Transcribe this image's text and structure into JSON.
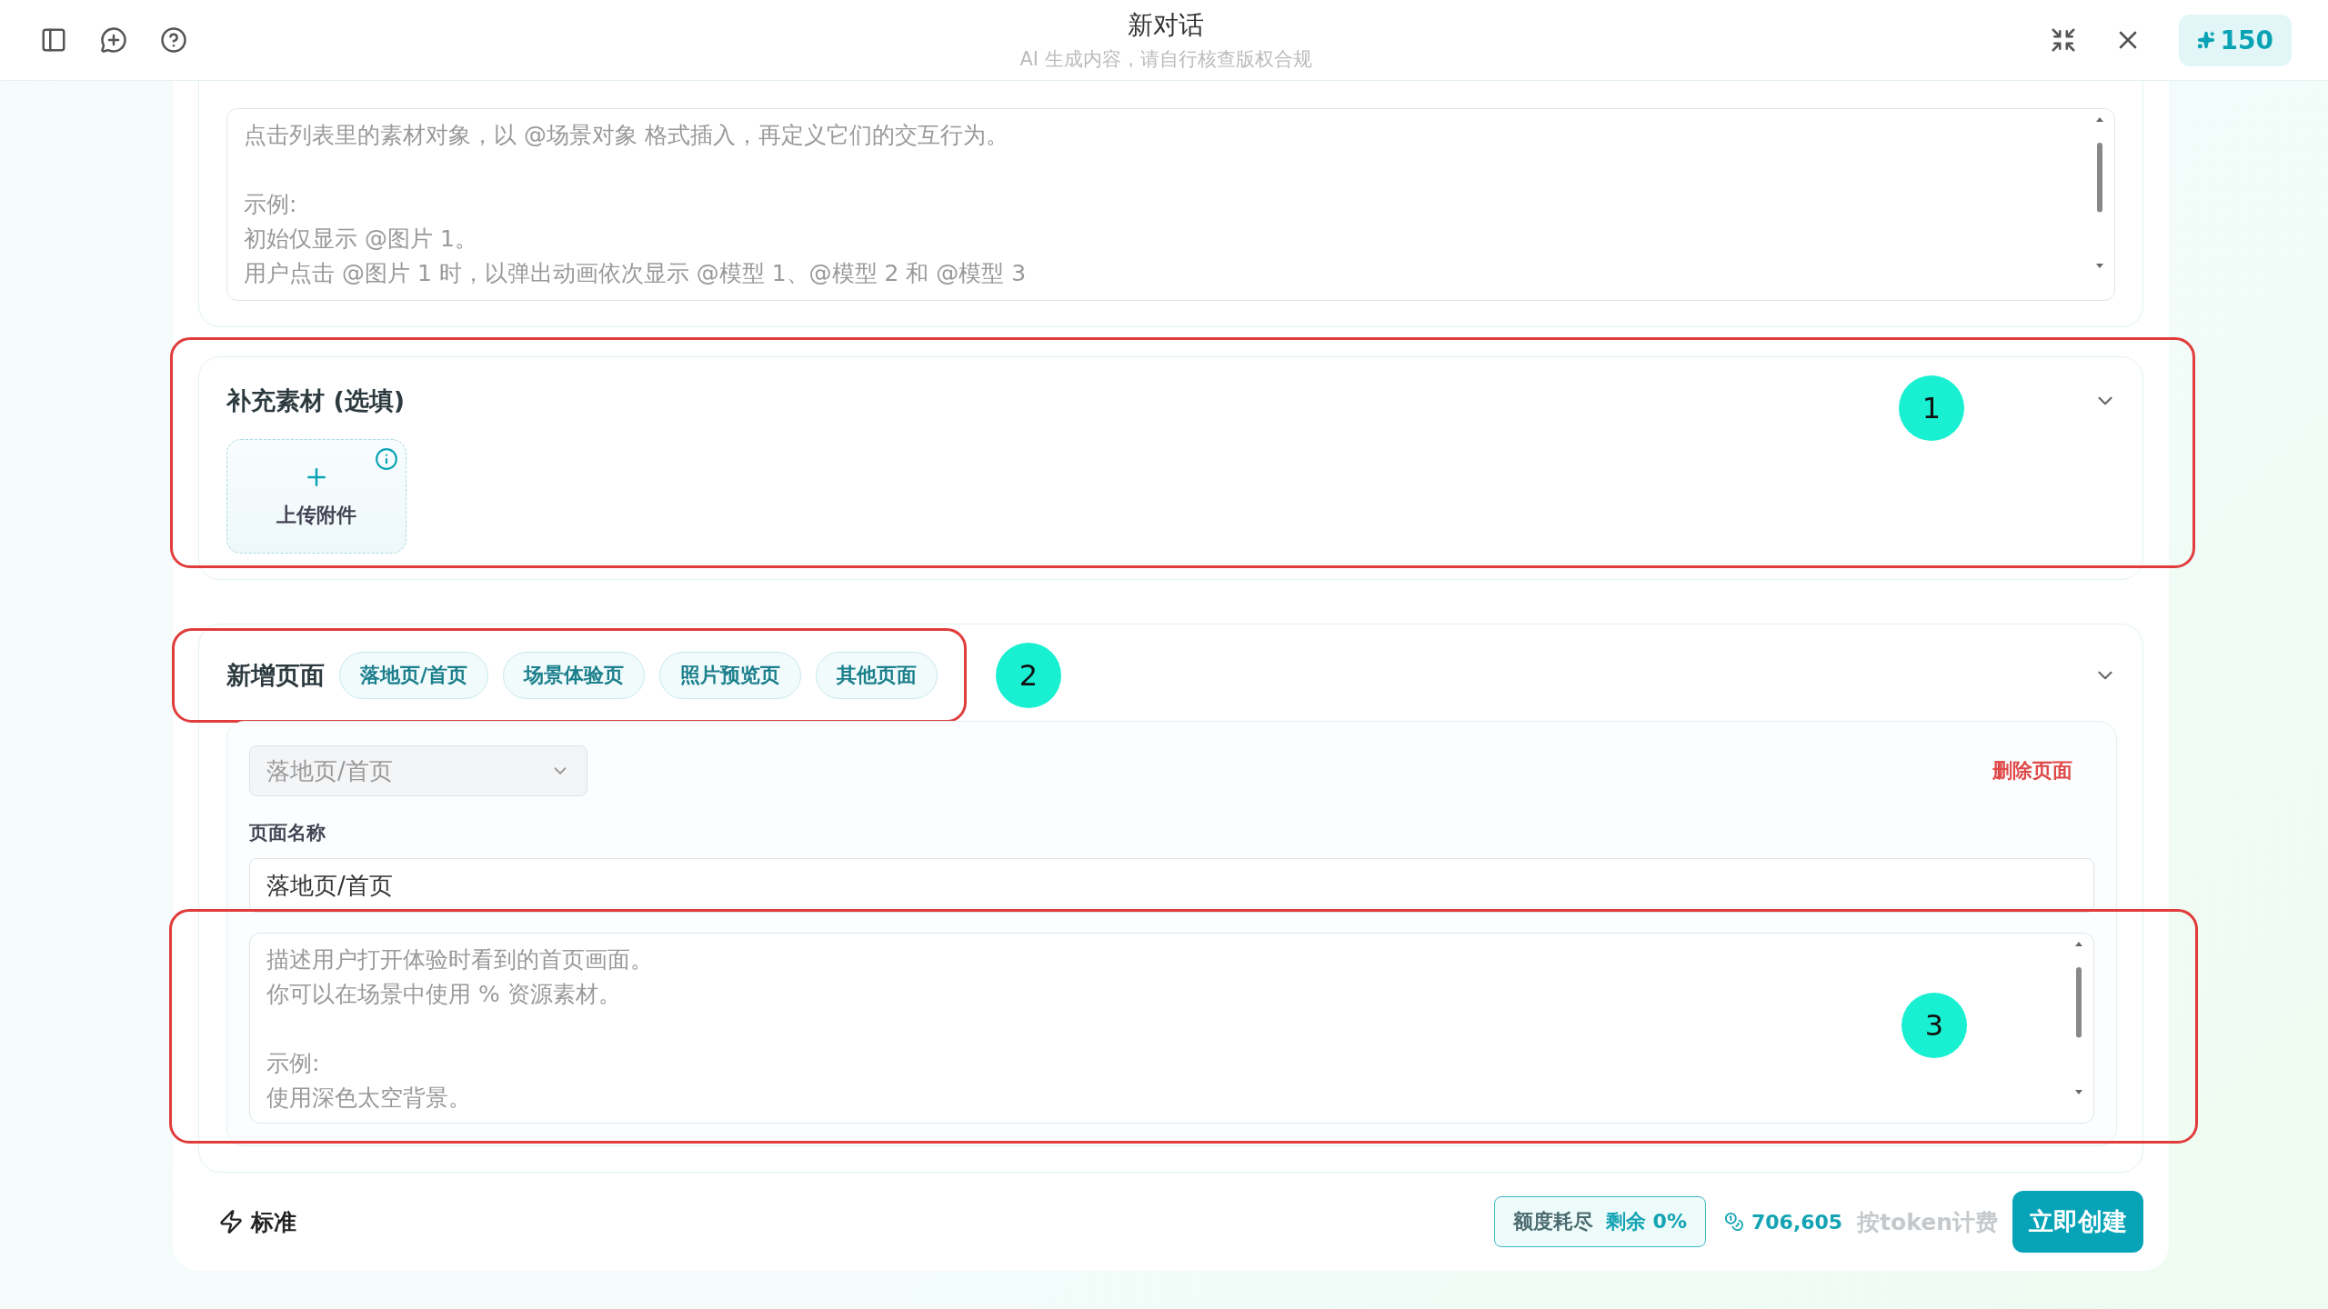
{
  "topbar": {
    "title": "新对话",
    "subtitle": "AI 生成内容，请自行核查版权合规",
    "credits": "150"
  },
  "interaction_field": {
    "paragraphs": [
      [
        "点击列表里的素材对象，以 @场景对象 格式插入，再定义它们的交互行为。"
      ],
      [
        "示例:",
        "初始仅显示 @图片 1。",
        "用户点击 @图片 1 时，以弹出动画依次显示 @模型 1、@模型 2 和 @模型 3"
      ]
    ]
  },
  "materials_section": {
    "title": "补充素材 (选填)",
    "expanded": true,
    "upload_label": "上传附件",
    "annotation": "1"
  },
  "pages_section": {
    "title": "新增页面",
    "expanded": true,
    "annotation": "2",
    "page_types": [
      "落地页/首页",
      "场景体验页",
      "照片预览页",
      "其他页面"
    ],
    "page": {
      "type_select": "落地页/首页",
      "type_disabled": true,
      "delete": "删除页面",
      "name_label": "页面名称",
      "name_value": "落地页/首页",
      "description_paragraphs": [
        [
          "描述用户打开体验时看到的首页画面。",
          "你可以在场景中使用 % 资源素材。"
        ],
        [
          "示例:",
          "使用深色太空背景。"
        ]
      ],
      "annotation": "3"
    }
  },
  "footer": {
    "mode": "标准",
    "quota": "额度耗尽",
    "remaining": "剩余 0%",
    "tokens": "706,605",
    "billing": "按token计费",
    "create": "立即创建"
  }
}
